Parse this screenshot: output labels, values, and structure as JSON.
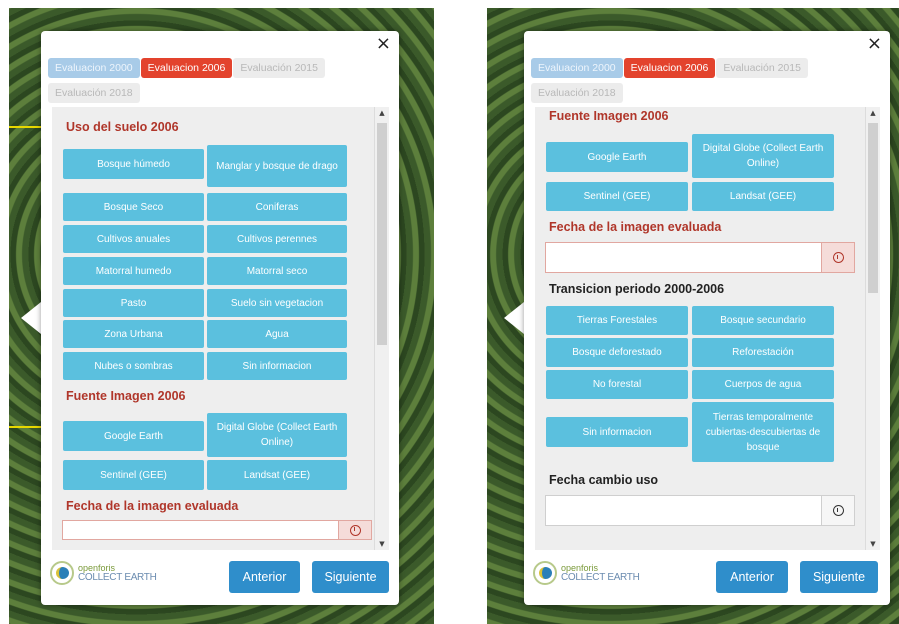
{
  "tabs": [
    {
      "label": "Evaluacion 2000",
      "state": "visited"
    },
    {
      "label": "Evaluacion 2006",
      "state": "active"
    },
    {
      "label": "Evaluación 2015",
      "state": "disabled"
    },
    {
      "label": "Evaluación 2018",
      "state": "disabled"
    }
  ],
  "close_symbol": "×",
  "left": {
    "land_use_title": "Uso del suelo 2006",
    "land_use_options": [
      "Bosque húmedo",
      "Manglar y bosque de drago",
      "Bosque Seco",
      "Coniferas",
      "Cultivos anuales",
      "Cultivos perennes",
      "Matorral humedo",
      "Matorral seco",
      "Pasto",
      "Suelo sin vegetacion",
      "Zona Urbana",
      "Agua",
      "Nubes o sombras",
      "Sin informacion"
    ],
    "source_title": "Fuente Imagen 2006",
    "source_options": [
      "Google Earth",
      "Digital Globe (Collect Earth Online)",
      "Sentinel (GEE)",
      "Landsat (GEE)"
    ],
    "date_title": "Fecha de la imagen evaluada"
  },
  "right": {
    "source_title": "Fuente Imagen 2006",
    "source_options": [
      "Google Earth",
      "Digital Globe (Collect Earth Online)",
      "Sentinel (GEE)",
      "Landsat (GEE)"
    ],
    "date_title": "Fecha de la imagen evaluada",
    "date_value": "",
    "transition_title": "Transicion periodo 2000-2006",
    "transition_options": [
      "Tierras Forestales",
      "Bosque secundario",
      "Bosque deforestado",
      "Reforestación",
      "No forestal",
      "Cuerpos de agua",
      "Sin informacion",
      "Tierras temporalmente cubiertas-descubiertas de bosque"
    ],
    "change_date_title": "Fecha cambio uso",
    "change_date_value": ""
  },
  "logo": {
    "line1": "openforis",
    "line2": "COLLECT EARTH"
  },
  "buttons": {
    "previous": "Anterior",
    "next": "Siguiente"
  },
  "colors": {
    "tab_active": "#e3432d",
    "option": "#5bc0de",
    "nav_button": "#2f8ecb",
    "heading_red": "#b0362a"
  }
}
